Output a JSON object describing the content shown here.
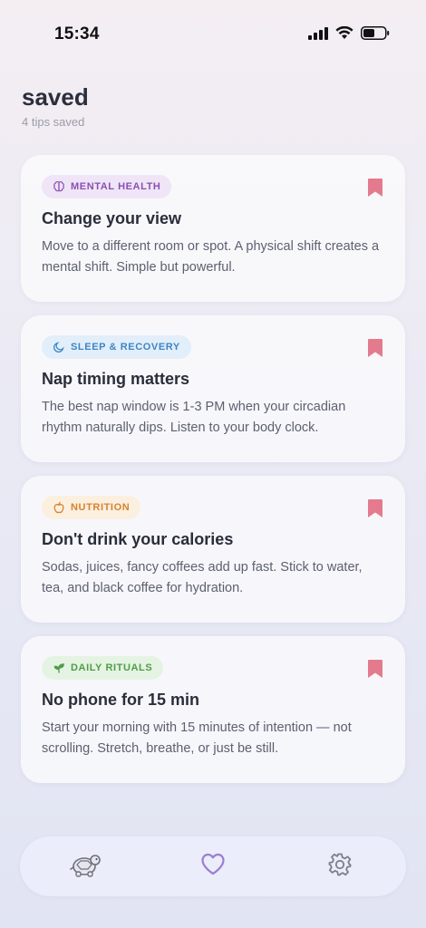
{
  "status_bar": {
    "time": "15:34"
  },
  "header": {
    "title": "saved",
    "subtitle": "4 tips saved"
  },
  "colors": {
    "bookmark": "#e47a8d",
    "mental_health_bg": "#efe5f6",
    "mental_health_fg": "#8a4fb4",
    "sleep_bg": "#e2eefa",
    "sleep_fg": "#3d86c6",
    "nutrition_bg": "#fbefe0",
    "nutrition_fg": "#d9822b",
    "daily_bg": "#e5f3e3",
    "daily_fg": "#4f9d47",
    "nav_active": "#9a7fd0"
  },
  "cards": [
    {
      "category": "MENTAL HEALTH",
      "category_icon": "brain-icon",
      "title": "Change your view",
      "body": "Move to a different room or spot. A physical shift creates a mental shift. Simple but powerful."
    },
    {
      "category": "SLEEP & RECOVERY",
      "category_icon": "moon-icon",
      "title": "Nap timing matters",
      "body": "The best nap window is 1-3 PM when your circadian rhythm naturally dips. Listen to your body clock."
    },
    {
      "category": "NUTRITION",
      "category_icon": "apple-icon",
      "title": "Don't drink your calories",
      "body": "Sodas, juices, fancy coffees add up fast. Stick to water, tea, and black coffee for hydration."
    },
    {
      "category": "DAILY RITUALS",
      "category_icon": "sprout-icon",
      "title": "No phone for 15 min",
      "body": "Start your morning with 15 minutes of intention — not scrolling. Stretch, breathe, or just be still."
    }
  ],
  "nav": {
    "items": [
      {
        "icon": "turtle-icon",
        "active": false
      },
      {
        "icon": "heart-icon",
        "active": true
      },
      {
        "icon": "gear-icon",
        "active": false
      }
    ]
  }
}
